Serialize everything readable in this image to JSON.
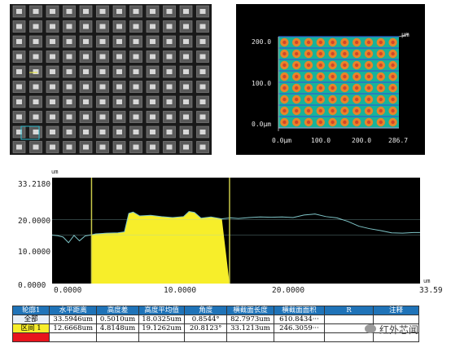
{
  "map3d": {
    "yticks": [
      "200.0",
      "100.0",
      "0.0μm"
    ],
    "xticks": [
      "0.0μm",
      "100.0",
      "200.0",
      "286.7"
    ],
    "corner_label": "μm"
  },
  "profile": {
    "unit_y": "um",
    "unit_x": "um",
    "yticks": [
      "33.2180",
      "20.0000",
      "10.0000",
      "0.0000"
    ],
    "xticks": [
      "0.0000",
      "10.0000",
      "20.0000",
      "33.59"
    ],
    "colors": {
      "fill": "#f7ee2a",
      "line": "#7fc6c9",
      "marker": "#c9c94a",
      "bg": "#000000"
    }
  },
  "table": {
    "headers": [
      "轮廓1",
      "水平距离",
      "高度差",
      "高度平均值",
      "角度",
      "横截面长度",
      "横截面面积",
      "R",
      "注释"
    ],
    "rows": [
      [
        "全部",
        "33.5946um",
        "0.5010um",
        "18.0325um",
        "0.8544°",
        "82.7973um",
        "610.8434···",
        "",
        ""
      ],
      [
        "区间 1",
        "12.6668um",
        "4.8148um",
        "19.1262um",
        "20.8123°",
        "33.1213um",
        "246.3059···",
        "",
        ""
      ]
    ]
  },
  "watermark": "红外芯闻"
}
